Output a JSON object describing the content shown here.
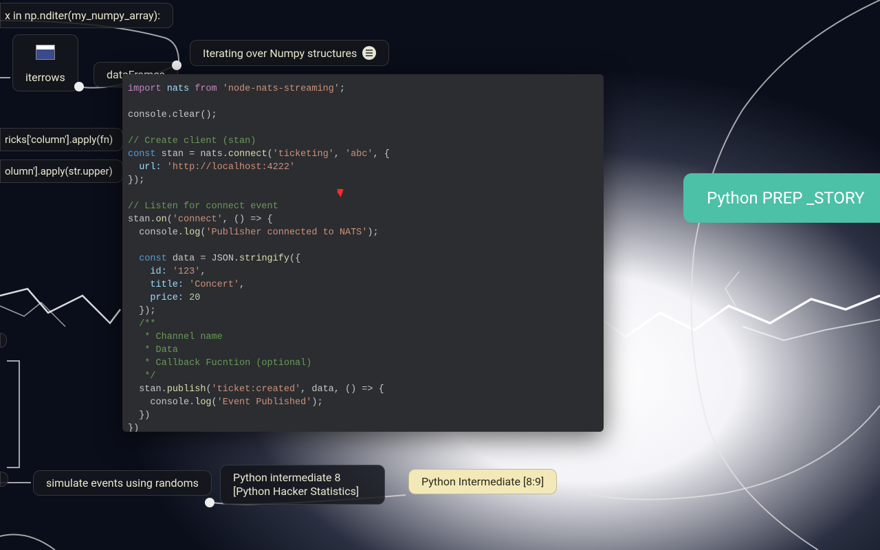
{
  "nodes": {
    "nditer": "x in np.nditer(my_numpy_array):",
    "iterrows": "iterrows",
    "dataframes": "dataFrames",
    "iterating_numpy": "Iterating over Numpy structures",
    "apply_fn": "ricks['column'].apply(fn)",
    "apply_upper": "olumn'].apply(str.upper)",
    "simulate": "simulate events using randoms",
    "py_int_8": "Python intermediate 8 [Python Hacker Statistics]",
    "py_int_89": "Python Intermediate [8:9]",
    "py_prep": "Python PREP _STORY"
  },
  "code": {
    "l1": {
      "a": "import",
      "b": " nats ",
      "c": "from",
      "d": " 'node-nats-streaming'",
      "e": ";"
    },
    "l3": "console.clear();",
    "l5": "// Create client (stan)",
    "l6": {
      "a": "const",
      "b": " stan = nats.",
      "c": "connect",
      "d": "(",
      "e": "'ticketing'",
      "f": ", ",
      "g": "'abc'",
      "h": ", {"
    },
    "l7": {
      "a": "  url: ",
      "b": "'http://localhost:4222'"
    },
    "l8": "});",
    "l10": "// Listen for connect event",
    "l11": {
      "a": "stan.",
      "b": "on",
      "c": "(",
      "d": "'connect'",
      "e": ", () => {"
    },
    "l12": {
      "a": "  console.",
      "b": "log",
      "c": "(",
      "d": "'Publisher connected to NATS'",
      "e": ");"
    },
    "l14": {
      "a": "  const",
      "b": " data = JSON.",
      "c": "stringify",
      "d": "({"
    },
    "l15": {
      "a": "    id: ",
      "b": "'123'",
      "c": ","
    },
    "l16": {
      "a": "    title: ",
      "b": "'Concert'",
      "c": ","
    },
    "l17": {
      "a": "    price: ",
      "b": "20"
    },
    "l18": "  });",
    "l19": "  /**",
    "l20": "   * Channel name",
    "l21": "   * Data",
    "l22": "   * Callback Fucntion (optional)",
    "l23": "   */",
    "l24": {
      "a": "  stan.",
      "b": "publish",
      "c": "(",
      "d": "'ticket:created'",
      "e": ", data, () => {"
    },
    "l25": {
      "a": "    console.",
      "b": "log",
      "c": "(",
      "d": "'Event Published'",
      "e": ");"
    },
    "l26": "  })",
    "l27": "})"
  }
}
